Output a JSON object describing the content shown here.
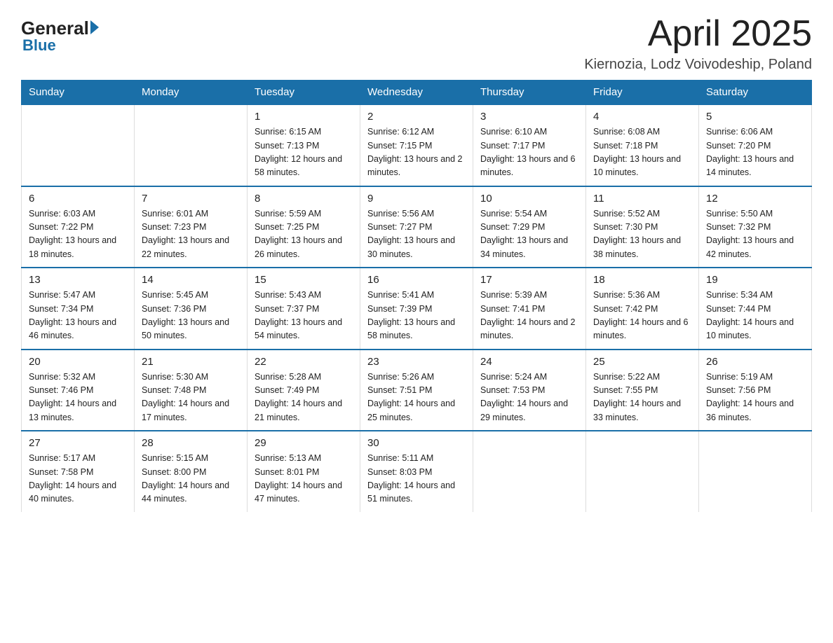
{
  "header": {
    "logo_general": "General",
    "logo_blue": "Blue",
    "month_title": "April 2025",
    "location": "Kiernozia, Lodz Voivodeship, Poland"
  },
  "weekdays": [
    "Sunday",
    "Monday",
    "Tuesday",
    "Wednesday",
    "Thursday",
    "Friday",
    "Saturday"
  ],
  "weeks": [
    [
      {
        "day": "",
        "sunrise": "",
        "sunset": "",
        "daylight": ""
      },
      {
        "day": "",
        "sunrise": "",
        "sunset": "",
        "daylight": ""
      },
      {
        "day": "1",
        "sunrise": "Sunrise: 6:15 AM",
        "sunset": "Sunset: 7:13 PM",
        "daylight": "Daylight: 12 hours and 58 minutes."
      },
      {
        "day": "2",
        "sunrise": "Sunrise: 6:12 AM",
        "sunset": "Sunset: 7:15 PM",
        "daylight": "Daylight: 13 hours and 2 minutes."
      },
      {
        "day": "3",
        "sunrise": "Sunrise: 6:10 AM",
        "sunset": "Sunset: 7:17 PM",
        "daylight": "Daylight: 13 hours and 6 minutes."
      },
      {
        "day": "4",
        "sunrise": "Sunrise: 6:08 AM",
        "sunset": "Sunset: 7:18 PM",
        "daylight": "Daylight: 13 hours and 10 minutes."
      },
      {
        "day": "5",
        "sunrise": "Sunrise: 6:06 AM",
        "sunset": "Sunset: 7:20 PM",
        "daylight": "Daylight: 13 hours and 14 minutes."
      }
    ],
    [
      {
        "day": "6",
        "sunrise": "Sunrise: 6:03 AM",
        "sunset": "Sunset: 7:22 PM",
        "daylight": "Daylight: 13 hours and 18 minutes."
      },
      {
        "day": "7",
        "sunrise": "Sunrise: 6:01 AM",
        "sunset": "Sunset: 7:23 PM",
        "daylight": "Daylight: 13 hours and 22 minutes."
      },
      {
        "day": "8",
        "sunrise": "Sunrise: 5:59 AM",
        "sunset": "Sunset: 7:25 PM",
        "daylight": "Daylight: 13 hours and 26 minutes."
      },
      {
        "day": "9",
        "sunrise": "Sunrise: 5:56 AM",
        "sunset": "Sunset: 7:27 PM",
        "daylight": "Daylight: 13 hours and 30 minutes."
      },
      {
        "day": "10",
        "sunrise": "Sunrise: 5:54 AM",
        "sunset": "Sunset: 7:29 PM",
        "daylight": "Daylight: 13 hours and 34 minutes."
      },
      {
        "day": "11",
        "sunrise": "Sunrise: 5:52 AM",
        "sunset": "Sunset: 7:30 PM",
        "daylight": "Daylight: 13 hours and 38 minutes."
      },
      {
        "day": "12",
        "sunrise": "Sunrise: 5:50 AM",
        "sunset": "Sunset: 7:32 PM",
        "daylight": "Daylight: 13 hours and 42 minutes."
      }
    ],
    [
      {
        "day": "13",
        "sunrise": "Sunrise: 5:47 AM",
        "sunset": "Sunset: 7:34 PM",
        "daylight": "Daylight: 13 hours and 46 minutes."
      },
      {
        "day": "14",
        "sunrise": "Sunrise: 5:45 AM",
        "sunset": "Sunset: 7:36 PM",
        "daylight": "Daylight: 13 hours and 50 minutes."
      },
      {
        "day": "15",
        "sunrise": "Sunrise: 5:43 AM",
        "sunset": "Sunset: 7:37 PM",
        "daylight": "Daylight: 13 hours and 54 minutes."
      },
      {
        "day": "16",
        "sunrise": "Sunrise: 5:41 AM",
        "sunset": "Sunset: 7:39 PM",
        "daylight": "Daylight: 13 hours and 58 minutes."
      },
      {
        "day": "17",
        "sunrise": "Sunrise: 5:39 AM",
        "sunset": "Sunset: 7:41 PM",
        "daylight": "Daylight: 14 hours and 2 minutes."
      },
      {
        "day": "18",
        "sunrise": "Sunrise: 5:36 AM",
        "sunset": "Sunset: 7:42 PM",
        "daylight": "Daylight: 14 hours and 6 minutes."
      },
      {
        "day": "19",
        "sunrise": "Sunrise: 5:34 AM",
        "sunset": "Sunset: 7:44 PM",
        "daylight": "Daylight: 14 hours and 10 minutes."
      }
    ],
    [
      {
        "day": "20",
        "sunrise": "Sunrise: 5:32 AM",
        "sunset": "Sunset: 7:46 PM",
        "daylight": "Daylight: 14 hours and 13 minutes."
      },
      {
        "day": "21",
        "sunrise": "Sunrise: 5:30 AM",
        "sunset": "Sunset: 7:48 PM",
        "daylight": "Daylight: 14 hours and 17 minutes."
      },
      {
        "day": "22",
        "sunrise": "Sunrise: 5:28 AM",
        "sunset": "Sunset: 7:49 PM",
        "daylight": "Daylight: 14 hours and 21 minutes."
      },
      {
        "day": "23",
        "sunrise": "Sunrise: 5:26 AM",
        "sunset": "Sunset: 7:51 PM",
        "daylight": "Daylight: 14 hours and 25 minutes."
      },
      {
        "day": "24",
        "sunrise": "Sunrise: 5:24 AM",
        "sunset": "Sunset: 7:53 PM",
        "daylight": "Daylight: 14 hours and 29 minutes."
      },
      {
        "day": "25",
        "sunrise": "Sunrise: 5:22 AM",
        "sunset": "Sunset: 7:55 PM",
        "daylight": "Daylight: 14 hours and 33 minutes."
      },
      {
        "day": "26",
        "sunrise": "Sunrise: 5:19 AM",
        "sunset": "Sunset: 7:56 PM",
        "daylight": "Daylight: 14 hours and 36 minutes."
      }
    ],
    [
      {
        "day": "27",
        "sunrise": "Sunrise: 5:17 AM",
        "sunset": "Sunset: 7:58 PM",
        "daylight": "Daylight: 14 hours and 40 minutes."
      },
      {
        "day": "28",
        "sunrise": "Sunrise: 5:15 AM",
        "sunset": "Sunset: 8:00 PM",
        "daylight": "Daylight: 14 hours and 44 minutes."
      },
      {
        "day": "29",
        "sunrise": "Sunrise: 5:13 AM",
        "sunset": "Sunset: 8:01 PM",
        "daylight": "Daylight: 14 hours and 47 minutes."
      },
      {
        "day": "30",
        "sunrise": "Sunrise: 5:11 AM",
        "sunset": "Sunset: 8:03 PM",
        "daylight": "Daylight: 14 hours and 51 minutes."
      },
      {
        "day": "",
        "sunrise": "",
        "sunset": "",
        "daylight": ""
      },
      {
        "day": "",
        "sunrise": "",
        "sunset": "",
        "daylight": ""
      },
      {
        "day": "",
        "sunrise": "",
        "sunset": "",
        "daylight": ""
      }
    ]
  ]
}
